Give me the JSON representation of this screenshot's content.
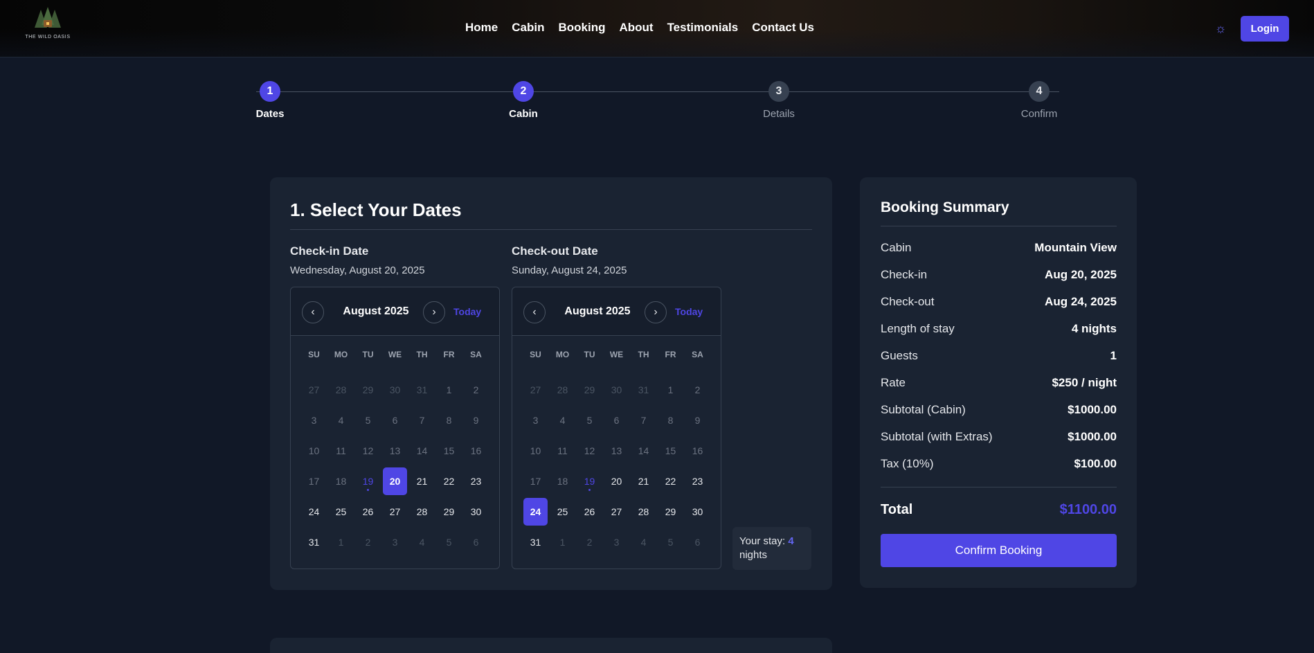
{
  "brand": {
    "name": "THE WILD OASIS"
  },
  "nav": {
    "items": [
      {
        "label": "Home"
      },
      {
        "label": "Cabin"
      },
      {
        "label": "Booking"
      },
      {
        "label": "About"
      },
      {
        "label": "Testimonials"
      },
      {
        "label": "Contact Us"
      }
    ],
    "theme_icon": "sun-icon",
    "login_label": "Login"
  },
  "stepper": {
    "steps": [
      {
        "number": "1",
        "label": "Dates",
        "state": "done"
      },
      {
        "number": "2",
        "label": "Cabin",
        "state": "done"
      },
      {
        "number": "3",
        "label": "Details",
        "state": "todo"
      },
      {
        "number": "4",
        "label": "Confirm",
        "state": "todo"
      }
    ]
  },
  "dates": {
    "title": "1. Select Your Dates",
    "checkin": {
      "label": "Check-in Date",
      "value": "Wednesday, August 20, 2025",
      "month": "August 2025",
      "today_label": "Today",
      "selected_day": "20"
    },
    "checkout": {
      "label": "Check-out Date",
      "value": "Sunday, August 24, 2025",
      "month": "August 2025",
      "today_label": "Today",
      "selected_day": "24"
    },
    "weekdays": [
      "SU",
      "MO",
      "TU",
      "WE",
      "TH",
      "FR",
      "SA"
    ],
    "today_day": "19",
    "weeks": [
      [
        "27",
        "28",
        "29",
        "30",
        "31",
        "1",
        "2"
      ],
      [
        "3",
        "4",
        "5",
        "6",
        "7",
        "8",
        "9"
      ],
      [
        "10",
        "11",
        "12",
        "13",
        "14",
        "15",
        "16"
      ],
      [
        "17",
        "18",
        "19",
        "20",
        "21",
        "22",
        "23"
      ],
      [
        "24",
        "25",
        "26",
        "27",
        "28",
        "29",
        "30"
      ],
      [
        "31",
        "1",
        "2",
        "3",
        "4",
        "5",
        "6"
      ]
    ],
    "stay": {
      "prefix": "Your stay:",
      "nights": "4",
      "suffix": "nights"
    }
  },
  "summary": {
    "title": "Booking Summary",
    "rows": [
      {
        "label": "Cabin",
        "value": "Mountain View"
      },
      {
        "label": "Check-in",
        "value": "Aug 20, 2025"
      },
      {
        "label": "Check-out",
        "value": "Aug 24, 2025"
      },
      {
        "label": "Length of stay",
        "value": "4 nights"
      },
      {
        "label": "Guests",
        "value": "1"
      },
      {
        "label": "Rate",
        "value": "$250 / night"
      },
      {
        "label": "Subtotal (Cabin)",
        "value": "$1000.00"
      },
      {
        "label": "Subtotal (with Extras)",
        "value": "$1000.00"
      },
      {
        "label": "Tax (10%)",
        "value": "$100.00"
      }
    ],
    "total_label": "Total",
    "total_value": "$1100.00",
    "confirm_label": "Confirm Booking"
  },
  "colors": {
    "accent": "#4f46e5",
    "background": "#111827",
    "card": "#1a2332"
  }
}
